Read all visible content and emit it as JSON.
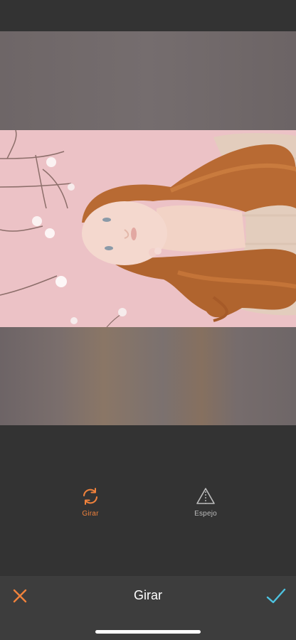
{
  "editor": {
    "title": "Girar",
    "cancel_icon": "close-icon",
    "apply_icon": "checkmark-icon"
  },
  "tools": [
    {
      "label": "Girar",
      "icon": "rotate-icon",
      "selected": true
    },
    {
      "label": "Espejo",
      "icon": "mirror-icon",
      "selected": false
    }
  ],
  "colors": {
    "accent": "#f0823c",
    "confirm": "#4ec3e0",
    "background": "#333333",
    "toolbar": "#3d3d3d",
    "inactive_label": "#bdbdbd"
  }
}
